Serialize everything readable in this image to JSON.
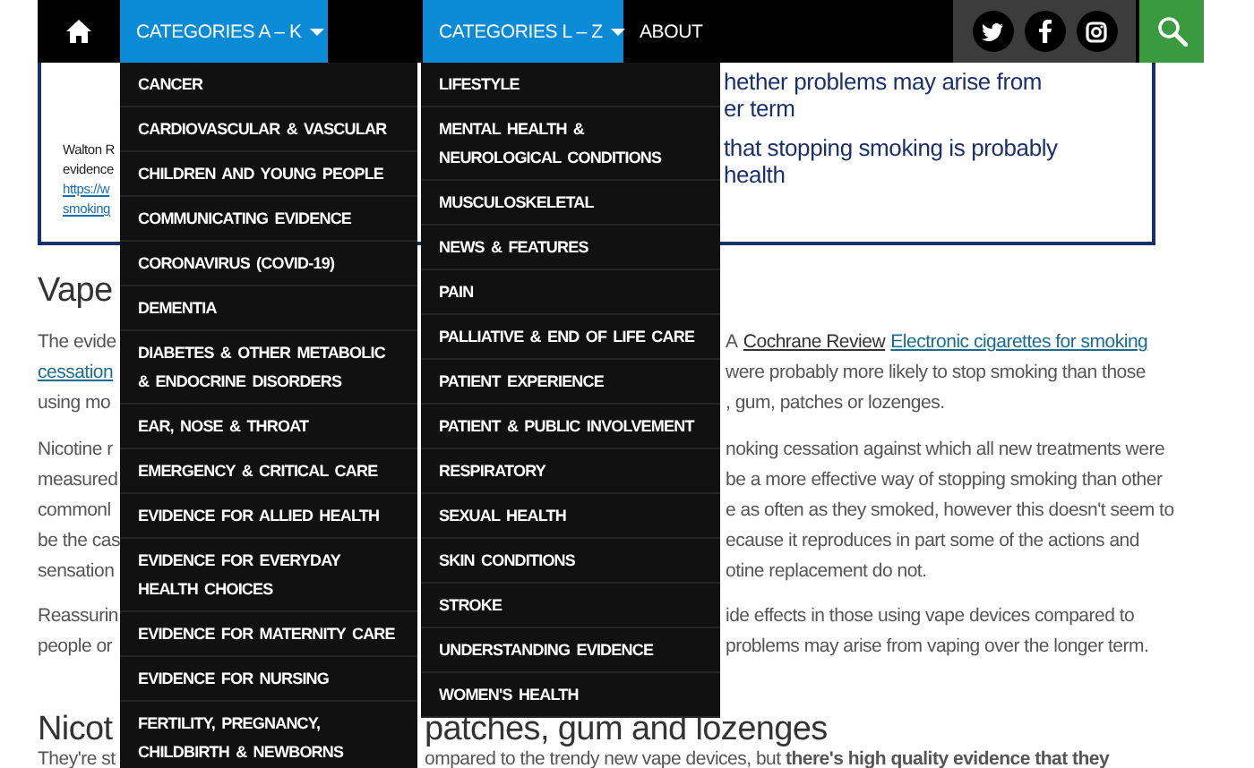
{
  "nav": {
    "items": [
      {
        "kind": "dropdown",
        "label": "CATEGORIES A – K",
        "expanded": true,
        "menu": [
          "CANCER",
          "CARDIOVASCULAR & VASCULAR",
          "CHILDREN AND YOUNG PEOPLE",
          "COMMUNICATING EVIDENCE",
          "CORONAVIRUS (COVID-19)",
          "DEMENTIA",
          "DIABETES & OTHER METABOLIC & ENDOCRINE DISORDERS",
          "EAR, NOSE & THROAT",
          "EMERGENCY & CRITICAL CARE",
          "EVIDENCE FOR ALLIED HEALTH",
          "EVIDENCE FOR EVERYDAY HEALTH CHOICES",
          "EVIDENCE FOR MATERNITY CARE",
          "EVIDENCE FOR NURSING",
          "FERTILITY, PREGNANCY, CHILDBIRTH & NEWBORNS"
        ]
      },
      {
        "kind": "dropdown",
        "label": "CATEGORIES L – Z",
        "expanded": true,
        "menu": [
          "LIFESTYLE",
          "MENTAL HEALTH & NEUROLOGICAL CONDITIONS",
          "MUSCULOSKELETAL",
          "NEWS & FEATURES",
          "PAIN",
          "PALLIATIVE & END OF LIFE CARE",
          "PATIENT EXPERIENCE",
          "PATIENT & PUBLIC INVOLVEMENT",
          "RESPIRATORY",
          "SEXUAL HEALTH",
          "SKIN CONDITIONS",
          "STROKE",
          "UNDERSTANDING EVIDENCE",
          "WOMEN'S HEALTH"
        ]
      },
      {
        "kind": "link",
        "label": "ABOUT",
        "expanded": false
      }
    ]
  },
  "quote_box": {
    "left_lines": [
      {
        "text": "Walton R",
        "kind": "text"
      },
      {
        "text": "evidence",
        "kind": "text"
      },
      {
        "text": "https://w",
        "kind": "link"
      },
      {
        "text": "smoking",
        "kind": "link"
      }
    ],
    "right_groups": [
      [
        "hether problems may arise from",
        "er term"
      ],
      [
        "that stopping smoking is probably",
        "health"
      ]
    ]
  },
  "blocks": [
    {
      "kind": "heading",
      "lines": [
        {
          "left": {
            "text": "Vape",
            "kind": "text"
          }
        }
      ]
    },
    {
      "kind": "paragraph",
      "lines": [
        {
          "left": {
            "text": "The evide",
            "kind": "text"
          },
          "right": [
            {
              "kind": "text",
              "text": "A"
            },
            {
              "kind": "cite",
              "text": "Cochrane Review"
            },
            {
              "kind": "link",
              "text": "Electronic cigarettes for smoking"
            }
          ]
        },
        {
          "left": {
            "text": "cessation",
            "kind": "link"
          },
          "right": [
            {
              "kind": "text",
              "text": "were probably more likely to stop smoking than those"
            }
          ]
        },
        {
          "left": {
            "text": "using mo",
            "kind": "text"
          },
          "right": [
            {
              "kind": "text",
              "text": ", gum, patches or lozenges."
            }
          ]
        }
      ]
    },
    {
      "kind": "paragraph",
      "lines": [
        {
          "left": {
            "text": "Nicotine r",
            "kind": "text"
          },
          "right": [
            {
              "kind": "text",
              "text": "noking cessation against which all new treatments were"
            }
          ]
        },
        {
          "left": {
            "text": "measured",
            "kind": "text"
          },
          "right": [
            {
              "kind": "text",
              "text": "be a more effective way of stopping smoking than other"
            }
          ]
        },
        {
          "left": {
            "text": "commonl",
            "kind": "text"
          },
          "right": [
            {
              "kind": "text",
              "text": "e as often as they smoked, however this doesn't seem to"
            }
          ]
        },
        {
          "left": {
            "text": "be the cas",
            "kind": "text"
          },
          "right": [
            {
              "kind": "text",
              "text": "ecause it reproduces in part some of the actions and"
            }
          ]
        },
        {
          "left": {
            "text": "sensation",
            "kind": "text"
          },
          "right": [
            {
              "kind": "text",
              "text": "otine replacement do not."
            }
          ]
        }
      ]
    },
    {
      "kind": "paragraph",
      "lines": [
        {
          "left": {
            "text": "Reassurin",
            "kind": "text"
          },
          "right": [
            {
              "kind": "text",
              "text": "ide effects in those using vape devices compared to"
            }
          ]
        },
        {
          "left": {
            "text": "people or",
            "kind": "text"
          },
          "right": [
            {
              "kind": "text",
              "text": "problems may arise from vaping over the longer term."
            }
          ]
        }
      ]
    },
    {
      "kind": "heading_open",
      "lines": [
        {
          "left": {
            "text": "Nicot",
            "kind": "text"
          },
          "right": [
            {
              "kind": "text",
              "text": "patches, gum and lozenges"
            }
          ]
        }
      ]
    },
    {
      "kind": "paragraph_open",
      "lines": [
        {
          "left": {
            "text": "They're st",
            "kind": "text"
          },
          "right": [
            {
              "kind": "text",
              "text": "ompared to the trendy new vape devices, but **there's high quality evidence that they**"
            }
          ]
        }
      ]
    }
  ]
}
